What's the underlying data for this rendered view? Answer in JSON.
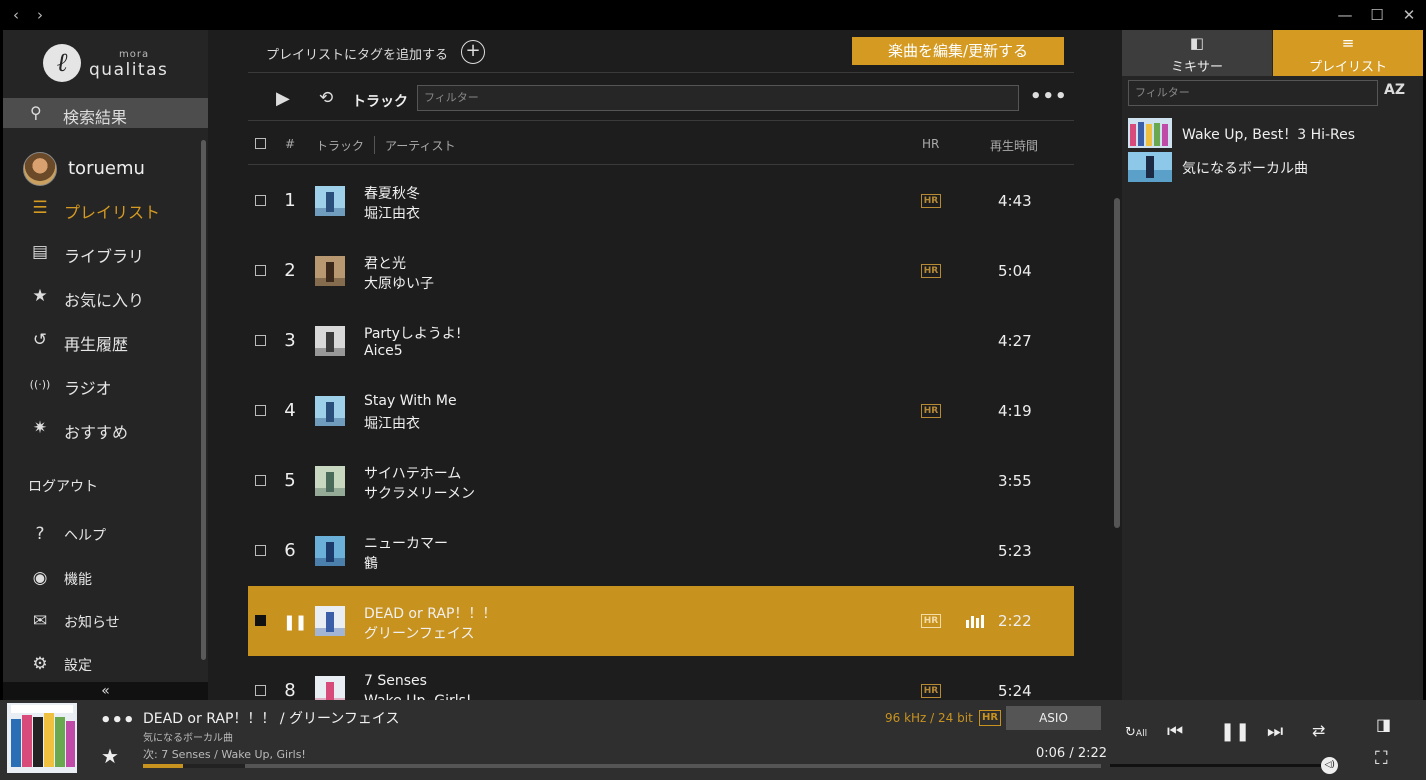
{
  "colors": {
    "accent": "#d49a21",
    "playing_row": "#c8921e",
    "background": "#1d1d1d",
    "sidebar": "#252525"
  },
  "window": {
    "back_icon": "chevron-left-icon",
    "forward_icon": "chevron-right-icon",
    "min_icon": "minimize-icon",
    "max_icon": "maximize-icon",
    "close_icon": "close-icon"
  },
  "logo": {
    "mora": "mora",
    "qualitas": "qualitas"
  },
  "sidebar": {
    "search_label": "検索結果",
    "username": "toruemu",
    "nav": [
      {
        "label": "プレイリスト",
        "icon": "playlist-icon",
        "active": true
      },
      {
        "label": "ライブラリ",
        "icon": "library-icon",
        "active": false
      },
      {
        "label": "お気に入り",
        "icon": "star-icon",
        "active": false
      },
      {
        "label": "再生履歴",
        "icon": "history-icon",
        "active": false
      },
      {
        "label": "ラジオ",
        "icon": "radio-icon",
        "active": false
      },
      {
        "label": "おすすめ",
        "icon": "recommend-icon",
        "active": false
      }
    ],
    "logout": "ログアウト",
    "bottom_nav": [
      {
        "label": "ヘルプ",
        "icon": "help-icon"
      },
      {
        "label": "機能",
        "icon": "new-icon"
      },
      {
        "label": "お知らせ",
        "icon": "mail-icon"
      },
      {
        "label": "設定",
        "icon": "gear-icon"
      }
    ],
    "collapse": "«"
  },
  "main": {
    "add_tag": "プレイリストにタグを追加する",
    "edit_button": "楽曲を編集/更新する",
    "toolbar_label": "トラック",
    "filter_placeholder": "フィルター",
    "columns": {
      "num": "#",
      "track": "トラック",
      "artist": "アーティスト",
      "hr": "HR",
      "duration": "再生時間"
    },
    "tracks": [
      {
        "num": "1",
        "title": "春夏秋冬",
        "artist": "堀江由衣",
        "hr": true,
        "duration": "4:43",
        "playing": false
      },
      {
        "num": "2",
        "title": "君と光",
        "artist": "大原ゆい子",
        "hr": true,
        "duration": "5:04",
        "playing": false
      },
      {
        "num": "3",
        "title": "Partyしようよ!",
        "artist": "Aice5",
        "hr": false,
        "duration": "4:27",
        "playing": false
      },
      {
        "num": "4",
        "title": "Stay With Me",
        "artist": "堀江由衣",
        "hr": true,
        "duration": "4:19",
        "playing": false
      },
      {
        "num": "5",
        "title": "サイハテホーム",
        "artist": "サクラメリーメン",
        "hr": false,
        "duration": "3:55",
        "playing": false
      },
      {
        "num": "6",
        "title": "ニューカマー",
        "artist": "鶴",
        "hr": false,
        "duration": "5:23",
        "playing": false
      },
      {
        "num": "7",
        "title": "DEAD or RAP！！！",
        "artist": "グリーンフェイス",
        "hr": true,
        "duration": "2:22",
        "playing": true
      },
      {
        "num": "8",
        "title": "7 Senses",
        "artist": "Wake Up, Girls!",
        "hr": true,
        "duration": "5:24",
        "playing": false
      }
    ],
    "hr_badge": "HR"
  },
  "right_panel": {
    "tabs": [
      {
        "label": "ミキサー",
        "icon": "mixer-icon",
        "active": false
      },
      {
        "label": "プレイリスト",
        "icon": "playlist-icon",
        "active": true
      }
    ],
    "filter_placeholder": "フィルター",
    "sort_label": "AZ",
    "playlists": [
      {
        "label": "Wake Up, Best！3 Hi-Res"
      },
      {
        "label": "気になるボーカル曲"
      }
    ]
  },
  "player": {
    "title": "DEAD or RAP！！！ / グリーンフェイス",
    "playlist": "気になるボーカル曲",
    "next": "次: 7 Senses / Wake Up, Girls!",
    "format": "96 kHz / 24 bit",
    "hr_badge": "HR",
    "output": "ASIO",
    "time": "0:06 / 2:22",
    "progress": 0.042,
    "buffered": 0.106,
    "volume": 0.97,
    "repeat_label": "All"
  }
}
